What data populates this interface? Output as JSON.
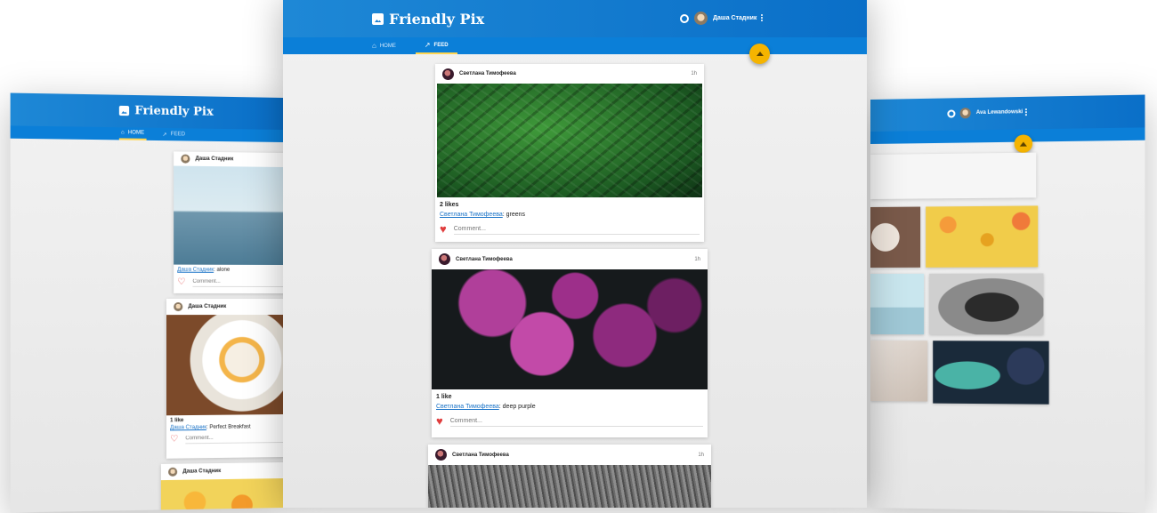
{
  "brand": {
    "left_title": "Friendly Pix",
    "center_title": "Friendly Pix"
  },
  "left_screen": {
    "tabs": {
      "home": "Home",
      "feed": "Feed"
    },
    "posts": [
      {
        "author": "Даша Стадник",
        "caption_author": "Даша Стадник",
        "caption_text": ": alone",
        "comment_placeholder": "Comment..."
      },
      {
        "author": "Даша Стадник",
        "likes": "1 like",
        "caption_author": "Даша Стадник",
        "caption_text": ": Perfect Breakfast",
        "comment_placeholder": "Comment..."
      },
      {
        "author": "Даша Стадник"
      }
    ]
  },
  "center_screen": {
    "user_name": "Даша Стадник",
    "tabs": {
      "home": "Home",
      "feed": "Feed"
    },
    "posts": [
      {
        "author": "Светлана Тимофеева",
        "time": "1h",
        "likes": "2 likes",
        "caption_author": "Светлана Тимофеева",
        "caption_text": ": greens",
        "comment_placeholder": "Comment..."
      },
      {
        "author": "Светлана Тимофеева",
        "time": "1h",
        "likes": "1 like",
        "caption_author": "Светлана Тимофеева",
        "caption_text": ": deep purple",
        "comment_placeholder": "Comment..."
      },
      {
        "author": "Светлана Тимофеева",
        "time": "1h"
      }
    ]
  },
  "right_screen": {
    "user_name": "Ava Lewandowski"
  },
  "colors": {
    "appbar": "#1e88d6",
    "tabbar": "#0b7fd8",
    "fab": "#f5b400",
    "heart": "#e03d3d",
    "link": "#1a73c7"
  },
  "icons": {
    "brand": "photo-icon",
    "search": "search-icon",
    "menu": "more-vert-icon",
    "home": "home-icon",
    "feed": "trending-icon",
    "upload": "upload-icon",
    "like": "heart-icon"
  }
}
